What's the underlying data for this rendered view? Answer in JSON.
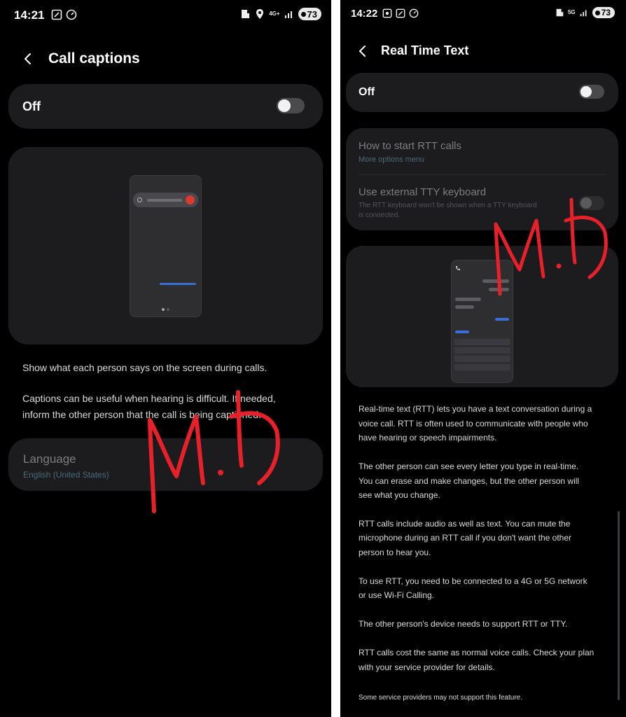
{
  "left": {
    "status": {
      "time": "14:21",
      "network": "4G+",
      "battery": "73"
    },
    "title": "Call captions",
    "toggle_label": "Off",
    "desc1": "Show what each person says on the screen during calls.",
    "desc2_line1": "Captions can be useful when hearing is difficult. If needed,",
    "desc2_line2": "inform the other person that the call is being captioned.",
    "language": {
      "title": "Language",
      "value": "English (United States)"
    }
  },
  "right": {
    "status": {
      "time": "14:22",
      "network": "5G",
      "battery": "73"
    },
    "title": "Real Time Text",
    "toggle_label": "Off",
    "how_to": {
      "title": "How to start RTT calls",
      "subtitle": "More options menu"
    },
    "tty": {
      "title": "Use external TTY keyboard",
      "sub_line1": "The RTT keyboard won't be shown when a TTY keyboard",
      "sub_line2": "is connected."
    },
    "paragraphs": [
      [
        "Real-time text (RTT) lets you have a text conversation during a",
        "voice call. RTT is often used to communicate with people who",
        "have hearing or speech impairments."
      ],
      [
        "The other person can see every letter you type in real-time.",
        "You can erase and make changes, but the other person will",
        "see what you change."
      ],
      [
        "RTT calls include audio as well as text. You can mute the",
        "microphone during an RTT call if you don't want the other",
        "person to hear you."
      ],
      [
        "To use RTT, you need to be connected to a 4G or 5G network",
        "or use Wi-Fi Calling."
      ],
      [
        "The other person's device needs to support RTT or TTY."
      ],
      [
        "RTT calls cost the same as normal voice calls. Check your plan",
        "with your service provider for details."
      ]
    ],
    "footnote": "Some service providers may not support this feature."
  },
  "colors": {
    "background": "#000000",
    "card": "#1c1c1e",
    "signature": "#e8202a",
    "caption_blue": "#3b6fd8",
    "end_call_red": "#d93a30"
  }
}
